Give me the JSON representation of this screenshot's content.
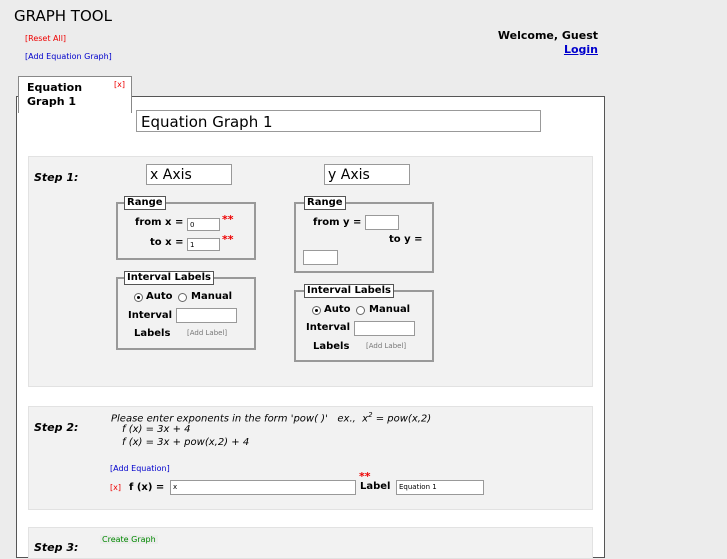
{
  "app_title": "GRAPH TOOL",
  "top_links": {
    "reset": "[Reset All]",
    "add_graph": "[Add Equation Graph]"
  },
  "user": {
    "welcome": "Welcome, Guest",
    "login": "Login"
  },
  "tab": {
    "label": "Equation Graph 1",
    "close": "[x]"
  },
  "graph_title": "Equation Graph 1",
  "step1": {
    "label": "Step 1:",
    "x_axis": {
      "title": "x Axis",
      "range_legend": "Range",
      "from_label": "from x =",
      "from_value": "0",
      "to_label": "to x =",
      "to_value": "1",
      "required_mark": "**",
      "interval_legend": "Interval Labels",
      "auto": "Auto",
      "manual": "Manual",
      "interval_label": "Interval",
      "interval_value": "",
      "labels_label": "Labels",
      "add_label": "[Add Label]"
    },
    "y_axis": {
      "title": "y Axis",
      "range_legend": "Range",
      "from_label": "from y =",
      "from_value": "",
      "to_label": "to y =",
      "to_value": "",
      "interval_legend": "Interval Labels",
      "auto": "Auto",
      "manual": "Manual",
      "interval_label": "Interval",
      "interval_value": "",
      "labels_label": "Labels",
      "add_label": "[Add Label]"
    }
  },
  "step2": {
    "label": "Step 2:",
    "instruction": "Please enter exponents in the form 'pow( )'   ex.,  x",
    "instruction_sup": "2",
    "instruction_tail": " = pow(x,2)",
    "example1": "f (x) = 3x + 4",
    "example2": "f (x) = 3x + pow(x,2) + 4",
    "add_equation": "[Add Equation]",
    "remove": "[x]",
    "fx_label": "f (x) =",
    "fx_value": "x",
    "required_mark": "**",
    "label_label": "Label",
    "label_value": "Equation 1"
  },
  "step3": {
    "label": "Step 3:",
    "create": "Create Graph"
  }
}
